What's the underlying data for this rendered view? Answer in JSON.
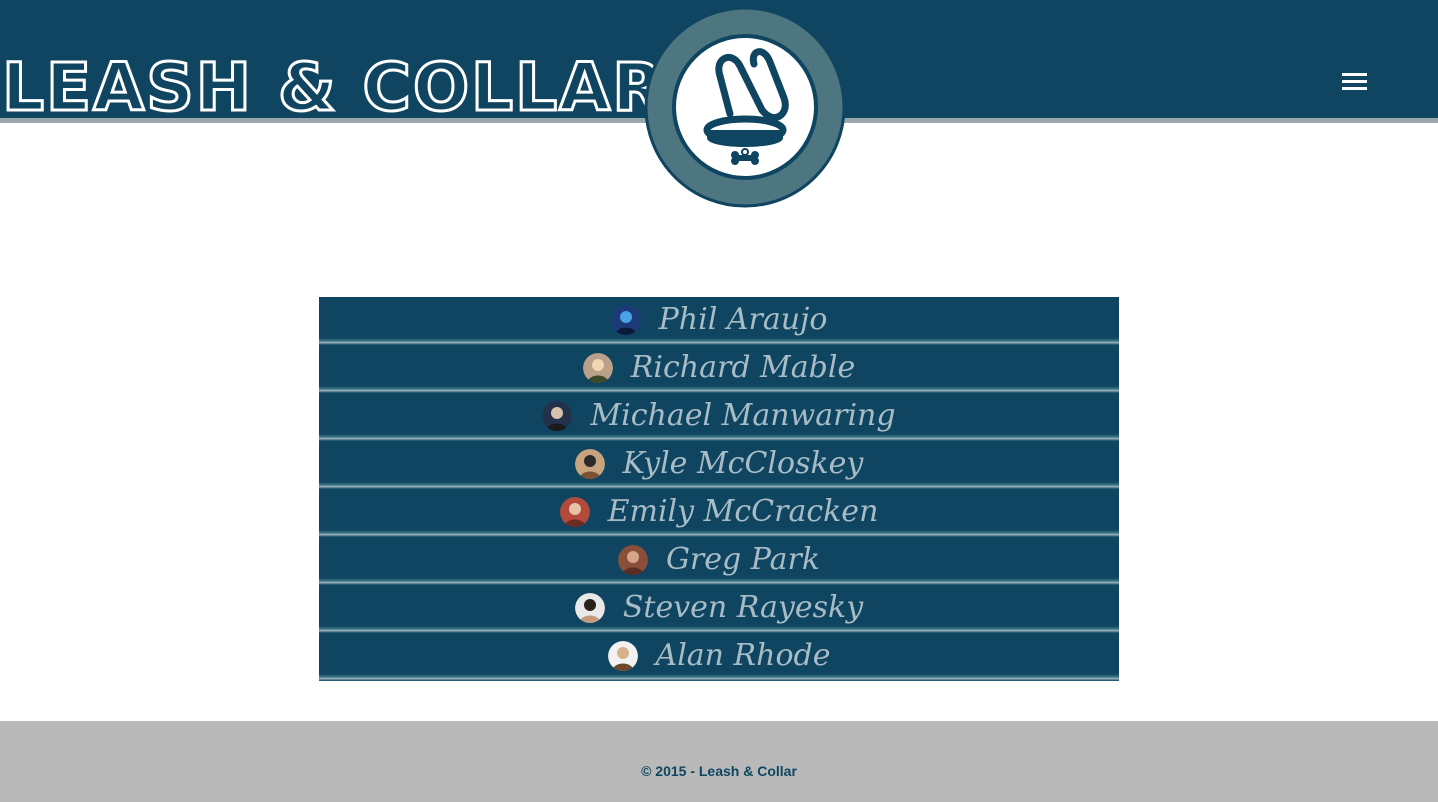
{
  "header": {
    "brand": "LEASH & COLLAR",
    "logo_icon": "leash-collar-logo-icon",
    "menu_icon": "hamburger-menu-icon",
    "colors": {
      "primary": "#0f4560",
      "badge_ring": "#4e7681",
      "rule": "#9aa7ae"
    }
  },
  "team": {
    "members": [
      {
        "name": "Phil Araujo",
        "avatar_icon": "avatar-photo"
      },
      {
        "name": "Richard Mable",
        "avatar_icon": "avatar-photo"
      },
      {
        "name": "Michael Manwaring",
        "avatar_icon": "avatar-photo"
      },
      {
        "name": "Kyle McCloskey",
        "avatar_icon": "avatar-photo"
      },
      {
        "name": "Emily McCracken",
        "avatar_icon": "avatar-photo"
      },
      {
        "name": "Greg Park",
        "avatar_icon": "avatar-photo"
      },
      {
        "name": "Steven Rayesky",
        "avatar_icon": "avatar-photo"
      },
      {
        "name": "Alan Rhode",
        "avatar_icon": "avatar-photo"
      }
    ]
  },
  "footer": {
    "copyright": "© 2015 - Leash & Collar",
    "background": "#b9b9b9"
  }
}
